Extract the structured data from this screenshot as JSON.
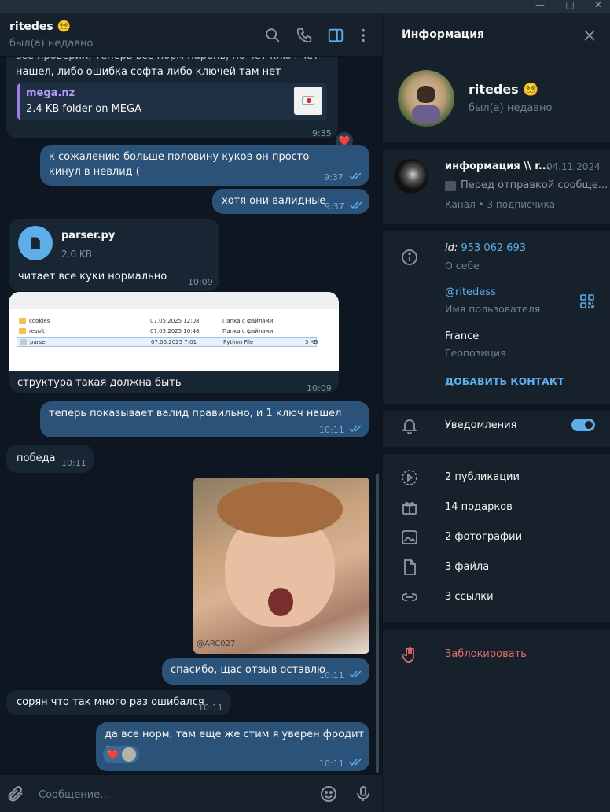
{
  "window": {
    "minimize": "—",
    "maximize": "□",
    "close": "✕"
  },
  "chat": {
    "title": "ritedes 😵‍💫",
    "status": "был(а) недавно",
    "messages": [
      {
        "type": "in",
        "text": "нашел, либо ошибка софта либо ключей там нет",
        "time": "9:35",
        "reaction": "❤️",
        "link": {
          "site": "mega.nz",
          "desc": "2.4 KB folder on MEGA"
        }
      },
      {
        "type": "out",
        "text": "к сожалению больше половину куков он просто кинул в невлид (",
        "time": "9:37"
      },
      {
        "type": "out",
        "text": "хотя они валидные",
        "time": "9:37"
      },
      {
        "type": "in",
        "file": {
          "name": "parser.py",
          "size": "2.0 KB"
        },
        "text": "читает все куки нормально",
        "time": "10:09"
      },
      {
        "type": "in",
        "text": "структура такая должна быть",
        "time": "10:09",
        "explorer": [
          {
            "name": "cookies",
            "date": "07.05.2025 12:08",
            "kind": "Папка с файлами",
            "size": ""
          },
          {
            "name": "result",
            "date": "07.05.2025 10:48",
            "kind": "Папка с файлами",
            "size": ""
          },
          {
            "name": "parser",
            "date": "07.05.2025 7:01",
            "kind": "Python File",
            "size": "3 КБ"
          }
        ]
      },
      {
        "type": "out",
        "text": "теперь показывает валид правильно, и 1 ключ нашел",
        "time": "10:11"
      },
      {
        "type": "in",
        "text": "победа",
        "time": "10:11"
      },
      {
        "type": "out",
        "photo_watermark": "@ARC027",
        "time": ""
      },
      {
        "type": "out",
        "text": "спасибо, щас отзыв оставлю",
        "time": "10:11"
      },
      {
        "type": "in",
        "text": "сорян что так много раз ошибался",
        "time": "10:11"
      },
      {
        "type": "out",
        "text": "да все норм, там еще же стим я уверен фродит люто",
        "time": "10:11",
        "reaction": "❤️"
      }
    ]
  },
  "composer": {
    "placeholder": "Сообщение..."
  },
  "info": {
    "title": "Информация",
    "name": "ritedes 😵‍💫",
    "status": "был(а) недавно",
    "channel": {
      "name": "информация \\\\ r...",
      "date": "04.11.2024",
      "preview": "Перед отправкой сообще...",
      "meta": "Канал • 3 подписчика"
    },
    "id_label": "id:",
    "id_value": "953 062 693",
    "about_label": "О себе",
    "username": "@ritedess",
    "username_label": "Имя пользователя",
    "location": "France",
    "location_label": "Геопозиция",
    "add_contact": "ДОБАВИТЬ КОНТАКТ",
    "notifications": "Уведомления",
    "notifications_on": true,
    "media": [
      "2 публикации",
      "14 подарков",
      "2 фотографии",
      "3 файла",
      "3 ссылки"
    ],
    "block": "Заблокировать"
  },
  "colors": {
    "accent": "#5eaeea",
    "danger": "#e56a6a",
    "outgoing": "#2b5278",
    "incoming": "#182533"
  }
}
